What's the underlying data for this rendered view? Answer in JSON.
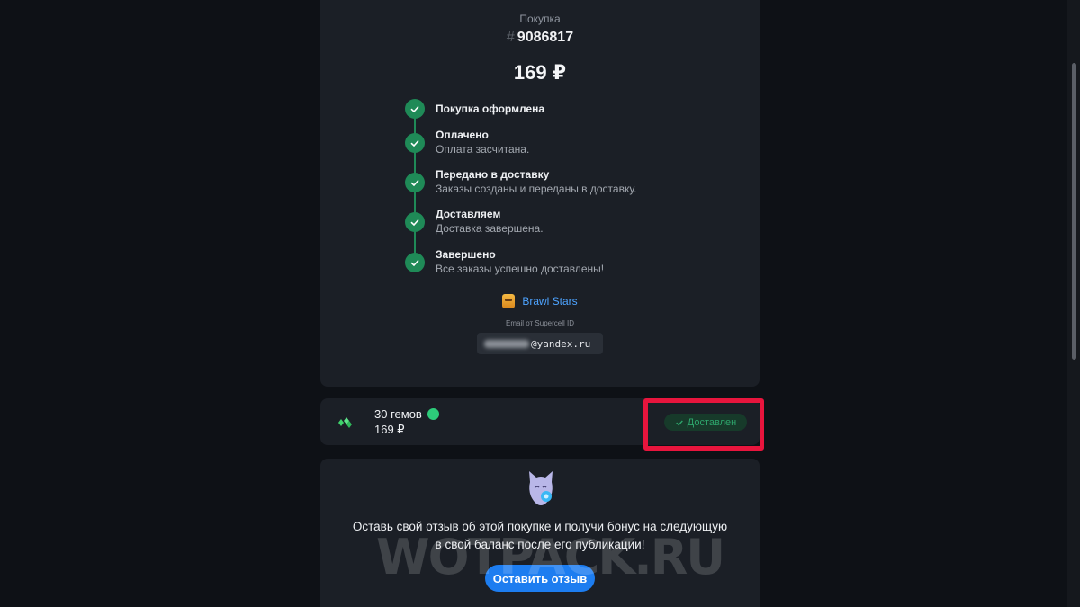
{
  "order": {
    "label": "Покупка",
    "hash": "#",
    "id": "9086817",
    "price": "169 ₽"
  },
  "timeline": [
    {
      "title": "Покупка оформлена",
      "desc": ""
    },
    {
      "title": "Оплачено",
      "desc": "Оплата засчитана."
    },
    {
      "title": "Передано в доставку",
      "desc": "Заказы созданы и переданы в доставку."
    },
    {
      "title": "Доставляем",
      "desc": "Доставка завершена."
    },
    {
      "title": "Завершено",
      "desc": "Все заказы успешно доставлены!"
    }
  ],
  "game": {
    "name": "Brawl Stars",
    "email_label": "Email от Supercell ID",
    "email_visible": "yandex.ru",
    "email_at": "@"
  },
  "item": {
    "name": "30 гемов",
    "price": "169 ₽",
    "status": "Доставлен"
  },
  "review": {
    "line1": "Оставь свой отзыв об этой покупке и получи бонус на следующую",
    "line2": "в свой баланс после его публикации!",
    "button": "Оставить отзыв"
  },
  "watermark": "WOTPACK.RU",
  "colors": {
    "success": "#1f8a57",
    "accent_link": "#4da3ff",
    "button": "#1d7df0",
    "highlight": "#e8153d"
  }
}
